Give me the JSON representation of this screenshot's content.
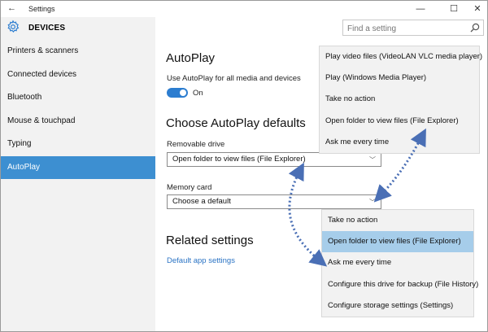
{
  "titlebar": {
    "back_glyph": "←",
    "title": "Settings",
    "minimize_glyph": "—",
    "maximize_glyph": "☐",
    "close_glyph": "✕"
  },
  "sidebar": {
    "header_icon": "gear-icon",
    "header": "DEVICES",
    "items": [
      {
        "label": "Printers & scanners"
      },
      {
        "label": "Connected devices"
      },
      {
        "label": "Bluetooth"
      },
      {
        "label": "Mouse & touchpad"
      },
      {
        "label": "Typing"
      },
      {
        "label": "AutoPlay"
      }
    ],
    "active_item": "AutoPlay"
  },
  "search": {
    "placeholder": "Find a setting",
    "icon": "search-icon"
  },
  "main": {
    "autoplay_heading": "AutoPlay",
    "autoplay_toggle_label": "Use AutoPlay for all media and devices",
    "autoplay_toggle_state": "On",
    "defaults_heading": "Choose AutoPlay defaults",
    "removable_drive_label": "Removable drive",
    "removable_drive_value": "Open folder to view files (File Explorer)",
    "memory_card_label": "Memory card",
    "memory_card_value": "Choose a default",
    "related_heading": "Related settings",
    "default_app_link": "Default app settings",
    "chevron_glyph": "﹀"
  },
  "popup_top": {
    "options": [
      "Play video files (VideoLAN VLC media player)",
      "Play (Windows Media Player)",
      "Take no action",
      "Open folder to view files (File Explorer)",
      "Ask me every time"
    ]
  },
  "popup_bottom": {
    "options": [
      "Take no action",
      "Open folder to view files (File Explorer)",
      "Ask me every time",
      "Configure this drive for backup (File History)",
      "Configure storage settings (Settings)"
    ],
    "selected": "Open folder to view files (File Explorer)"
  },
  "colors": {
    "accent": "#3d8fd1",
    "toggle_on": "#2c7dd0",
    "link": "#2a73c4",
    "selected_option": "#a6cdea",
    "arrow": "#4a6fb5"
  }
}
